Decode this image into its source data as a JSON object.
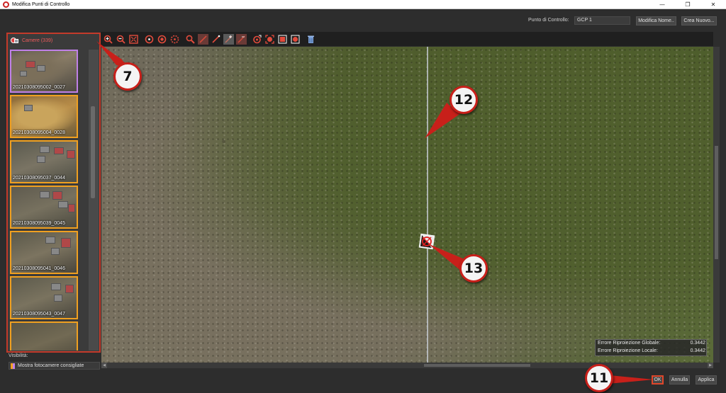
{
  "window": {
    "title": "Modifica Punti di Controllo",
    "controls": [
      "—",
      "❐",
      "✕"
    ]
  },
  "control_point": {
    "label": "Punto di Controllo:",
    "value": "GCP 1",
    "rename_button": "Modifica Nome..",
    "create_button": "Crea Nuovo..."
  },
  "sidebar": {
    "title": "Camere (339)",
    "thumbnails": [
      {
        "caption": "20210308095002_0027",
        "state": "selected"
      },
      {
        "caption": "20210308095004_0028",
        "state": "normal"
      },
      {
        "caption": "20210308095037_0044",
        "state": "normal"
      },
      {
        "caption": "20210308095039_0045",
        "state": "normal"
      },
      {
        "caption": "20210308095041_0046",
        "state": "normal"
      },
      {
        "caption": "20210308095043_0047",
        "state": "normal"
      },
      {
        "caption": "",
        "state": "normal"
      }
    ]
  },
  "visibility": {
    "label": "Visibilità:",
    "value": "Mostra fotocamere consigliate"
  },
  "toolbar": {
    "icons": [
      "zoom-in-icon",
      "zoom-out-icon",
      "fit-view-icon",
      "target-add-icon",
      "target-center-icon",
      "target-multi-icon",
      "search-icon",
      "line-red-icon",
      "line-diagonal-icon",
      "line-add-icon",
      "line-remove-icon",
      "pin-icon",
      "focus-icon",
      "stop-square-icon",
      "record-icon",
      "trash-icon"
    ]
  },
  "error_box": {
    "global_label": "Errore Riproiezione Globale:",
    "global_value": "0.3442",
    "local_label": "Errore Riproiezione Locale:",
    "local_value": "0.3442"
  },
  "bottom": {
    "ok": "OK",
    "cancel": "Annulla",
    "apply": "Applica"
  },
  "callouts": {
    "c7": "7",
    "c11": "11",
    "c12": "12",
    "c13": "13"
  },
  "colors": {
    "accent_red": "#c8201a",
    "thumb_border": "#f0a020",
    "thumb_selected": "#c080e8",
    "sidebar_title": "#f05b5b"
  }
}
